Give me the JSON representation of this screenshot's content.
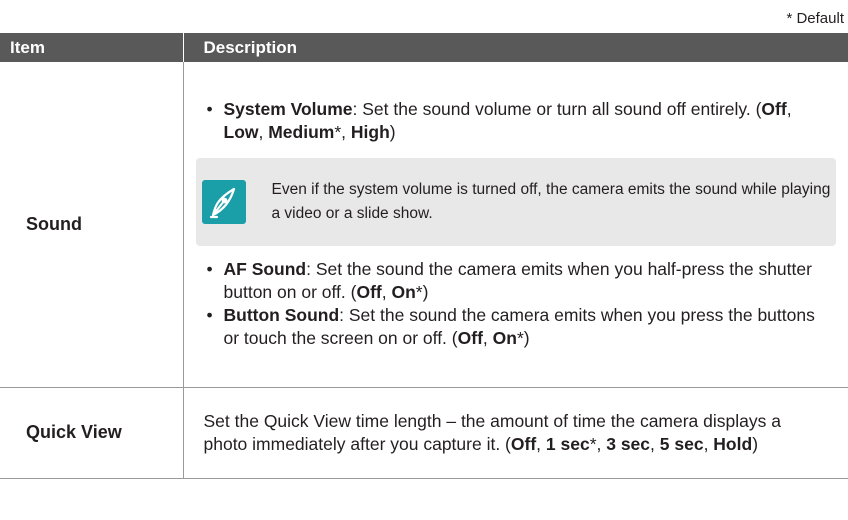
{
  "default_note": "* Default",
  "table": {
    "headers": {
      "item": "Item",
      "description": "Description"
    },
    "rows": {
      "sound": {
        "item": "Sound",
        "system_volume": {
          "term": "System Volume",
          "text": ": Set the sound volume or turn all sound off entirely. (",
          "options": [
            "Off",
            "Low",
            "Medium",
            "High"
          ],
          "default_marker": "*"
        },
        "note": {
          "icon": "pen-nib-icon",
          "text": "Even if the system volume is turned off, the camera emits the sound while playing a video or a slide show."
        },
        "af_sound": {
          "term": "AF Sound",
          "text": ": Set the sound the camera emits when you half-press the shutter button on or off. (",
          "options": [
            "Off",
            "On"
          ],
          "default_marker": "*"
        },
        "button_sound": {
          "term": "Button Sound",
          "text": ": Set the sound the camera emits when you press the buttons or touch the screen on or off. (",
          "options": [
            "Off",
            "On"
          ],
          "default_marker": "*"
        }
      },
      "quick_view": {
        "item": "Quick View",
        "text": "Set the Quick View time length – the amount of time the camera displays a photo immediately after you capture it. (",
        "options": [
          "Off",
          "1 sec",
          "3 sec",
          "5 sec",
          "Hold"
        ],
        "default_marker": "*"
      }
    }
  },
  "colors": {
    "header_bg": "#595959",
    "note_bg": "#e8e8e8",
    "note_icon_bg": "#1a9fa8"
  },
  "punctuation": {
    "comma": ", ",
    "close": ")"
  }
}
